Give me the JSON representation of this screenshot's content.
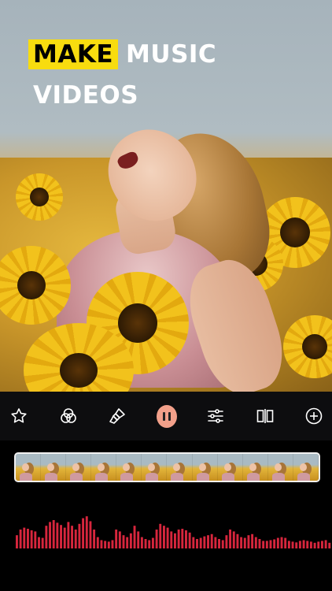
{
  "headline": {
    "highlight_word": "MAKE",
    "word_2": "MUSIC",
    "line_2": "VIDEOS"
  },
  "colors": {
    "highlight": "#f8dc0f",
    "play_button": "#f2a08a",
    "waveform": "#d7263d",
    "toolbar_bg": "#0d0d0f"
  },
  "toolbar": {
    "icons": [
      "star-icon",
      "filters-icon",
      "brush-icon",
      "pause-icon",
      "adjust-sliders-icon",
      "split-icon",
      "add-icon"
    ],
    "playback_state": "playing"
  },
  "timeline": {
    "frame_count": 12
  },
  "waveform": {
    "levels": [
      0.35,
      0.5,
      0.55,
      0.52,
      0.48,
      0.45,
      0.3,
      0.28,
      0.6,
      0.7,
      0.75,
      0.68,
      0.62,
      0.55,
      0.7,
      0.6,
      0.5,
      0.65,
      0.8,
      0.85,
      0.72,
      0.5,
      0.3,
      0.22,
      0.2,
      0.18,
      0.22,
      0.5,
      0.45,
      0.35,
      0.3,
      0.4,
      0.6,
      0.45,
      0.3,
      0.25,
      0.22,
      0.28,
      0.5,
      0.65,
      0.6,
      0.55,
      0.45,
      0.4,
      0.5,
      0.52,
      0.48,
      0.42,
      0.3,
      0.25,
      0.28,
      0.32,
      0.35,
      0.38,
      0.3,
      0.25,
      0.22,
      0.35,
      0.5,
      0.45,
      0.38,
      0.3,
      0.28,
      0.35,
      0.38,
      0.3,
      0.25,
      0.2,
      0.2,
      0.22,
      0.24,
      0.28,
      0.3,
      0.28,
      0.2,
      0.18,
      0.16,
      0.2,
      0.22,
      0.2,
      0.18,
      0.15,
      0.18,
      0.2,
      0.22,
      0.15
    ]
  }
}
